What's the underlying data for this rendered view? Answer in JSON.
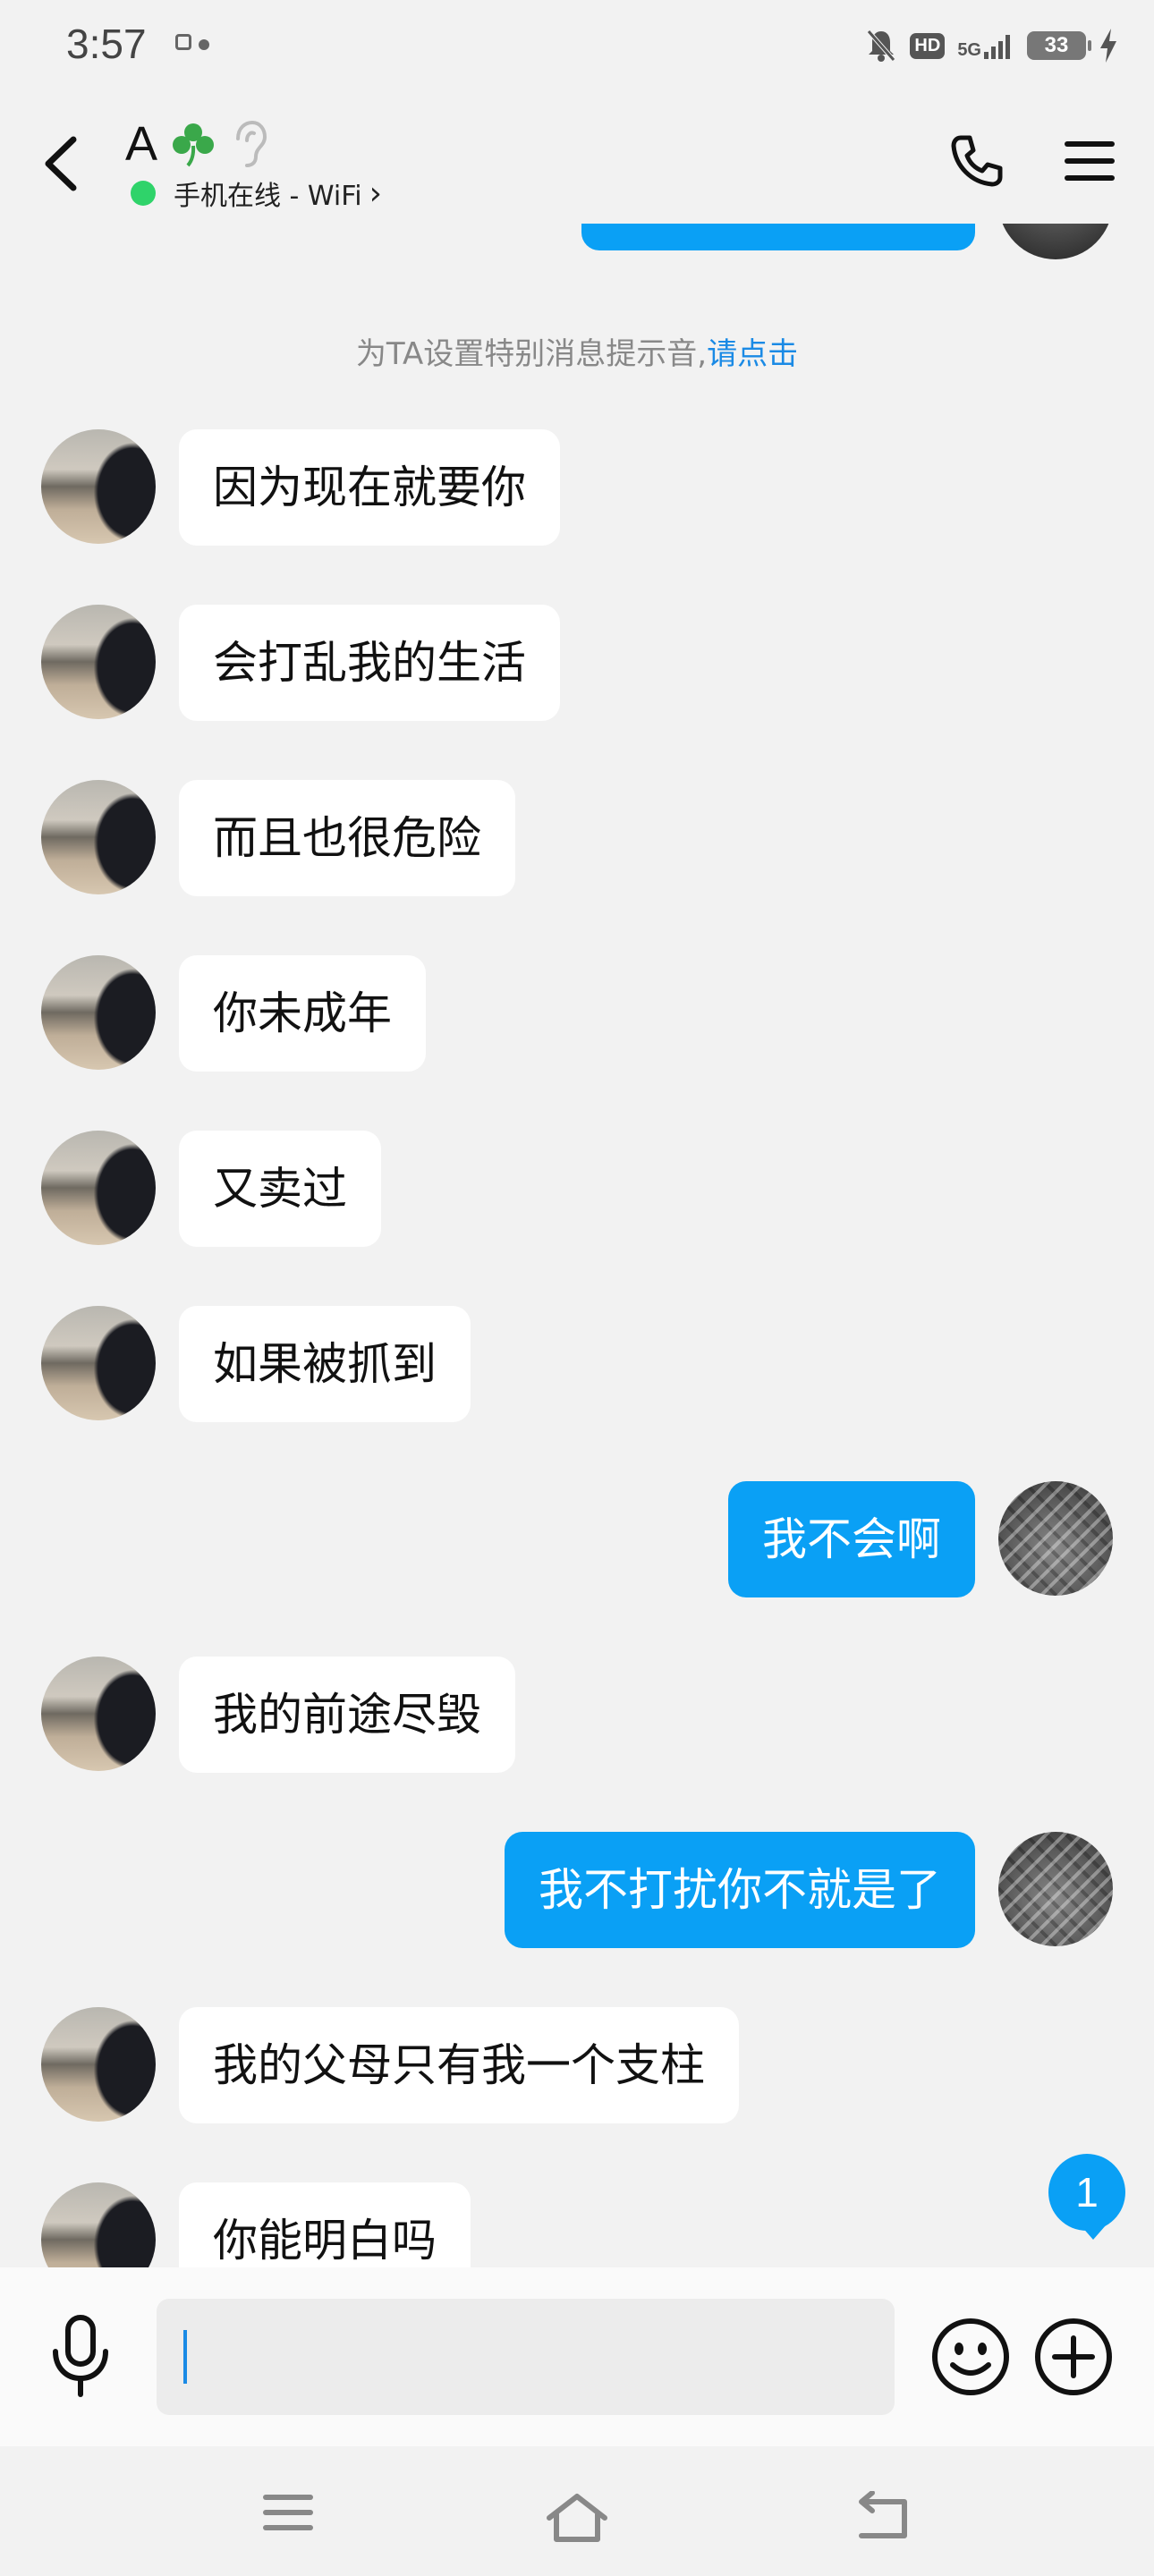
{
  "status_bar": {
    "time": "3:57",
    "hd": "HD",
    "network": "5G",
    "battery": "33"
  },
  "header": {
    "contact_name": "A",
    "status_text": "手机在线 - WiFi",
    "status_chevron": "›"
  },
  "system_tip": {
    "text": "为TA设置特别消息提示音,",
    "link": "请点击"
  },
  "messages": [
    {
      "from": "them",
      "text": "因为现在就要你"
    },
    {
      "from": "them",
      "text": "会打乱我的生活"
    },
    {
      "from": "them",
      "text": "而且也很危险"
    },
    {
      "from": "them",
      "text": "你未成年"
    },
    {
      "from": "them",
      "text": "又卖过"
    },
    {
      "from": "them",
      "text": "如果被抓到"
    },
    {
      "from": "me",
      "text": "我不会啊"
    },
    {
      "from": "them",
      "text": "我的前途尽毁"
    },
    {
      "from": "me",
      "text": "我不打扰你不就是了"
    },
    {
      "from": "them",
      "text": "我的父母只有我一个支柱"
    },
    {
      "from": "them",
      "text": "你能明白吗"
    }
  ],
  "unread_badge": "1",
  "input": {
    "placeholder": ""
  },
  "colors": {
    "accent": "#0aa0f5",
    "online": "#2fd36a",
    "link": "#1a8ae5",
    "background": "#f2f2f2"
  },
  "icons": [
    "back-arrow-icon",
    "clover-icon",
    "ear-icon",
    "phone-icon",
    "menu-icon",
    "mic-icon",
    "emoji-icon",
    "plus-icon",
    "nav-menu-icon",
    "nav-home-icon",
    "nav-back-icon"
  ]
}
